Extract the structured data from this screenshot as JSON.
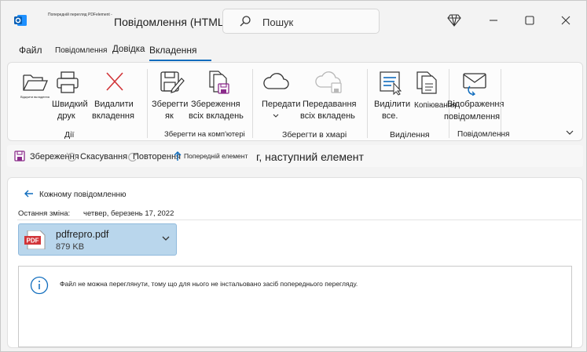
{
  "titlebar": {
    "tiny_title": "Попередній перегляд PDFelement -",
    "title": "Повідомлення (HTML)",
    "search_placeholder": "Пошук"
  },
  "tabs": [
    {
      "label": "Файл"
    },
    {
      "label": "Повідомлення"
    },
    {
      "label": "Довідка"
    },
    {
      "label": "Вкладення",
      "active": true
    }
  ],
  "ribbon": {
    "open_label": "Відкрити вкладення",
    "quick_print_line1": "Швидкий",
    "quick_print_line2": "друк",
    "delete_line1": "Видалити",
    "delete_line2": "вкладення",
    "actions_group": "Дії",
    "save_as_line1": "Зберегти",
    "save_as_line2": "як",
    "save_all_line1": "Збереження",
    "save_all_line2": "всіх вкладень",
    "save_to_pc_group": "Зберегти на комп'ютері",
    "send_label": "Передати",
    "send_all_line1": "Передавання",
    "send_all_line2": "всіх вкладень",
    "save_cloud_group": "Зберегти в хмарі",
    "select_all_line1": "Виділити",
    "select_all_line2": "все.",
    "copy_label": "Копіювання",
    "selection_group": "Виділення",
    "show_msg_line1": "Відображення",
    "show_msg_line2": "повідомлення",
    "message_group": "Повідомлення"
  },
  "qat": {
    "save": "Збереження",
    "undo": "Скасування",
    "redo": "Повторення",
    "prev": "Попередній елемент",
    "next": "г, наступний елемент"
  },
  "content": {
    "back_link": "Кожному повідомленню",
    "last_modified_label": "Остання зміна:",
    "last_modified_value": "четвер, березень 17, 2022",
    "attachment_name": "pdfrepro.pdf",
    "attachment_size": "879 KB",
    "preview_message": "Файл не можна переглянути, тому що для нього не інстальовано засіб попереднього перегляду."
  },
  "colors": {
    "accent": "#0f6cbd",
    "attachment_bg": "#b9d6ec",
    "delete_red": "#d13438",
    "save_purple": "#8b2c8b"
  }
}
